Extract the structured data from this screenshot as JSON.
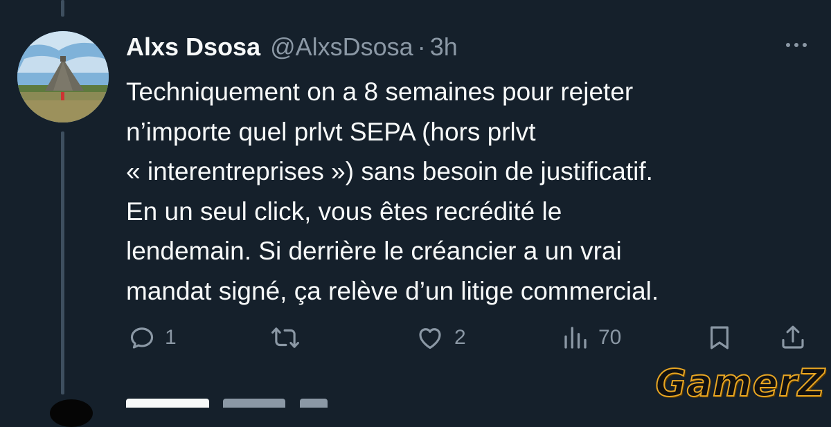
{
  "tweet": {
    "display_name": "Alxs Dsosa",
    "handle": "@AlxsDsosa",
    "separator": "·",
    "time": "3h",
    "text_lines": [
      "Techniquement on a 8 semaines pour rejeter",
      "n’importe quel prlvt SEPA (hors prlvt",
      "« interentreprises ») sans besoin de justificatif.",
      "En un seul click, vous êtes recrédité le",
      "lendemain. Si derrière le créancier a un vrai",
      "mandat signé, ça relève d’un litige commercial."
    ]
  },
  "actions": {
    "reply": {
      "icon": "reply-icon",
      "count": "1"
    },
    "retweet": {
      "icon": "retweet-icon",
      "count": ""
    },
    "like": {
      "icon": "heart-icon",
      "count": "2"
    },
    "views": {
      "icon": "views-icon",
      "count": "70"
    },
    "bookmark": {
      "icon": "bookmark-icon"
    },
    "share": {
      "icon": "share-icon"
    }
  },
  "watermark": "GamerZ",
  "colors": {
    "background": "#15202b",
    "text_primary": "#f7f9f9",
    "text_secondary": "#8b98a5",
    "thread_line": "#3e4f5f",
    "watermark_stroke": "#e8a623"
  }
}
